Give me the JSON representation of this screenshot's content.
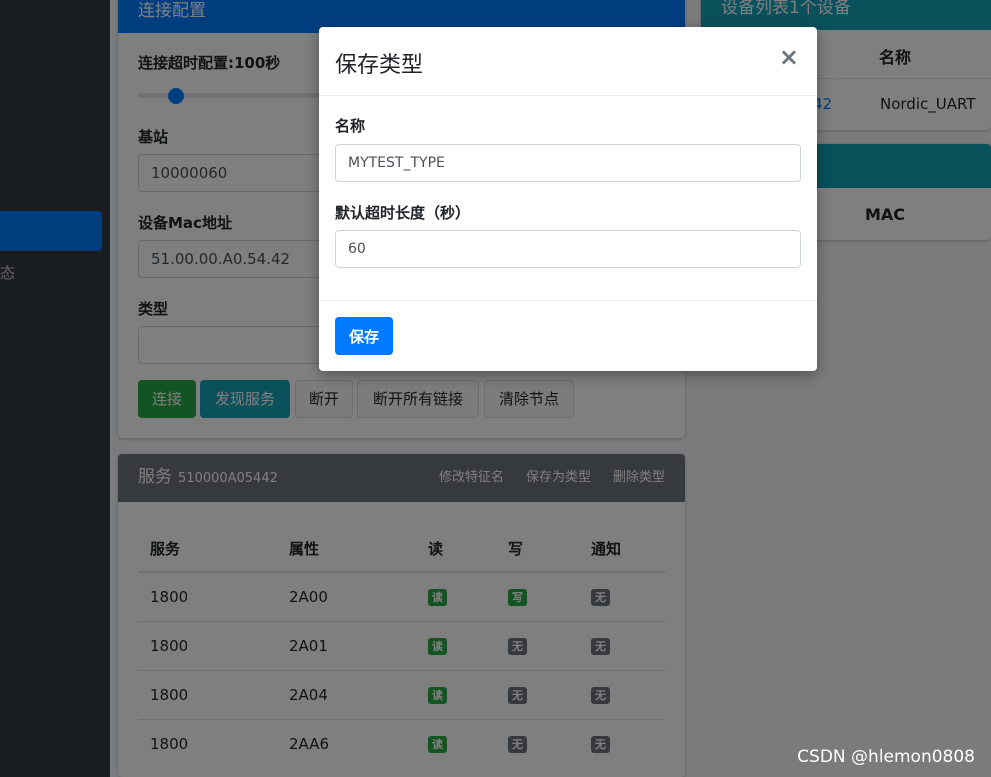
{
  "sidebar": {
    "partial_label": "态"
  },
  "connection_card": {
    "title": "连接配置",
    "timeout_label": "连接超时配置:100秒",
    "timeout_level": 0.28,
    "base_station_label": "基站",
    "base_station_value": "10000060",
    "mac_label": "设备Mac地址",
    "mac_value": "51.00.00.A0.54.42",
    "type_label": "类型",
    "type_value": "",
    "buttons": {
      "connect": "连接",
      "discover": "发现服务",
      "disconnect": "断开",
      "disconnect_all": "断开所有链接",
      "clear": "清除节点"
    }
  },
  "device_list": {
    "title": "设备列表1个设备",
    "col_name": "名称",
    "row_mac_partial": "42",
    "row_name": "Nordic_UART",
    "col_mac": "MAC"
  },
  "service_card": {
    "title": "服务",
    "subtitle": "510000A05442",
    "actions": {
      "rename": "修改特征名",
      "save_type": "保存为类型",
      "delete_type": "删除类型"
    },
    "headers": [
      "服务",
      "属性",
      "读",
      "写",
      "通知"
    ],
    "rows": [
      {
        "service": "1800",
        "attr": "2A00",
        "read": "读",
        "write": "写",
        "notify": "无"
      },
      {
        "service": "1800",
        "attr": "2A01",
        "read": "读",
        "write": "无",
        "notify": "无"
      },
      {
        "service": "1800",
        "attr": "2A04",
        "read": "读",
        "write": "无",
        "notify": "无"
      },
      {
        "service": "1800",
        "attr": "2AA6",
        "read": "读",
        "write": "无",
        "notify": "无"
      }
    ]
  },
  "modal": {
    "title": "保存类型",
    "close_symbol": "×",
    "name_label": "名称",
    "name_value": "MYTEST_TYPE",
    "timeout_label": "默认超时长度（秒）",
    "timeout_value": "60",
    "save_label": "保存"
  },
  "watermark": "CSDN @hlemon0808",
  "colors": {
    "primary": "#007bff",
    "success": "#28a745",
    "info": "#17a2b8",
    "secondary": "#6c757d"
  }
}
